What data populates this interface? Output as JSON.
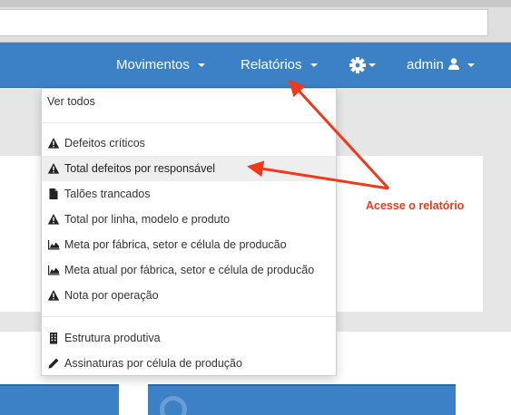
{
  "navbar": {
    "movimentos_label": "Movimentos",
    "relatorios_label": "Relatórios",
    "settings_icon": "gear-icon",
    "user_label": "admin",
    "user_icon": "user-icon",
    "background_color": "#3c80c6"
  },
  "reports_menu": {
    "view_all": "Ver todos",
    "items": [
      {
        "label": "Defeitos críticos",
        "icon": "warning-icon"
      },
      {
        "label": "Total defeitos por responsável",
        "icon": "warning-icon",
        "highlighted": true
      },
      {
        "label": "Talões trancados",
        "icon": "file-icon"
      },
      {
        "label": "Total por linha, modelo e produto",
        "icon": "warning-icon"
      },
      {
        "label": "Meta por fábrica, setor e célula de producão",
        "icon": "area-chart-icon"
      },
      {
        "label": "Meta atual por fábrica, setor e célula de producão",
        "icon": "area-chart-icon"
      },
      {
        "label": "Nota por operação",
        "icon": "warning-icon"
      },
      {
        "label": "Estrutura produtiva",
        "icon": "building-icon"
      },
      {
        "label": "Assinaturas por célula de produção",
        "icon": "pencil-icon"
      }
    ]
  },
  "annotation": {
    "text": "Acesse o relatório",
    "color": "#ee3a1a"
  }
}
